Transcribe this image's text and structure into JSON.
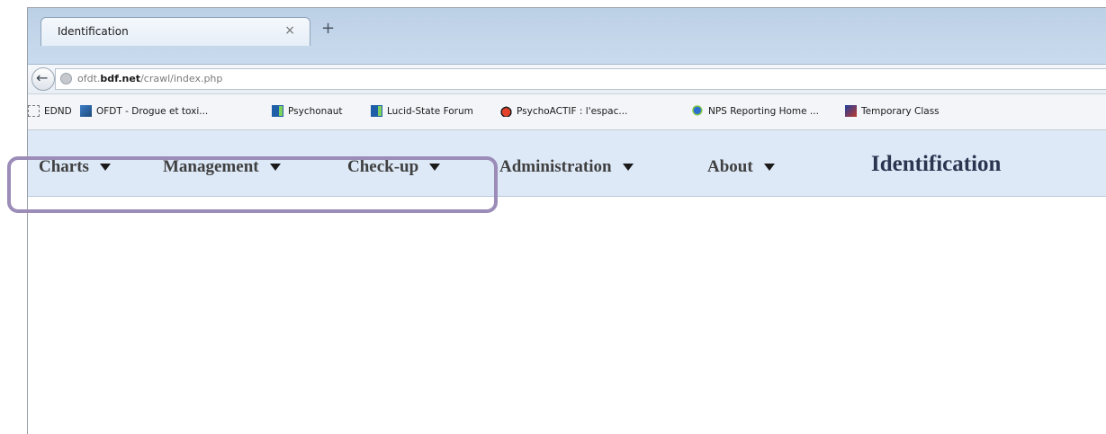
{
  "browser": {
    "tab": {
      "title": "Identification",
      "close_glyph": "×"
    },
    "new_tab_glyph": "+",
    "back_glyph": "←",
    "url": {
      "prefix": "ofdt.",
      "domain": "bdf.net",
      "path": "/crawl/index.php"
    },
    "bookmarks": [
      {
        "label": "EDND",
        "icon": "blank-page-icon"
      },
      {
        "label": "OFDT - Drogue et toxi...",
        "icon": "ofdt-icon"
      },
      {
        "label": "Psychonaut",
        "icon": "psychonaut-icon"
      },
      {
        "label": "Lucid-State Forum",
        "icon": "lucid-state-icon"
      },
      {
        "label": "PsychoACTIF : l'espac...",
        "icon": "psychoactif-icon"
      },
      {
        "label": "NPS Reporting Home ...",
        "icon": "nps-icon"
      },
      {
        "label": "Temporary Class",
        "icon": "temporary-class-icon"
      }
    ]
  },
  "site_menu": {
    "items": [
      {
        "label": "Charts"
      },
      {
        "label": "Management"
      },
      {
        "label": "Check-up"
      },
      {
        "label": "Administration"
      },
      {
        "label": "About"
      }
    ],
    "heading": "Identification"
  },
  "colors": {
    "menu_background": "#dde9f7",
    "heading_color": "#2a3550",
    "highlight_border": "#9b8cb8"
  }
}
